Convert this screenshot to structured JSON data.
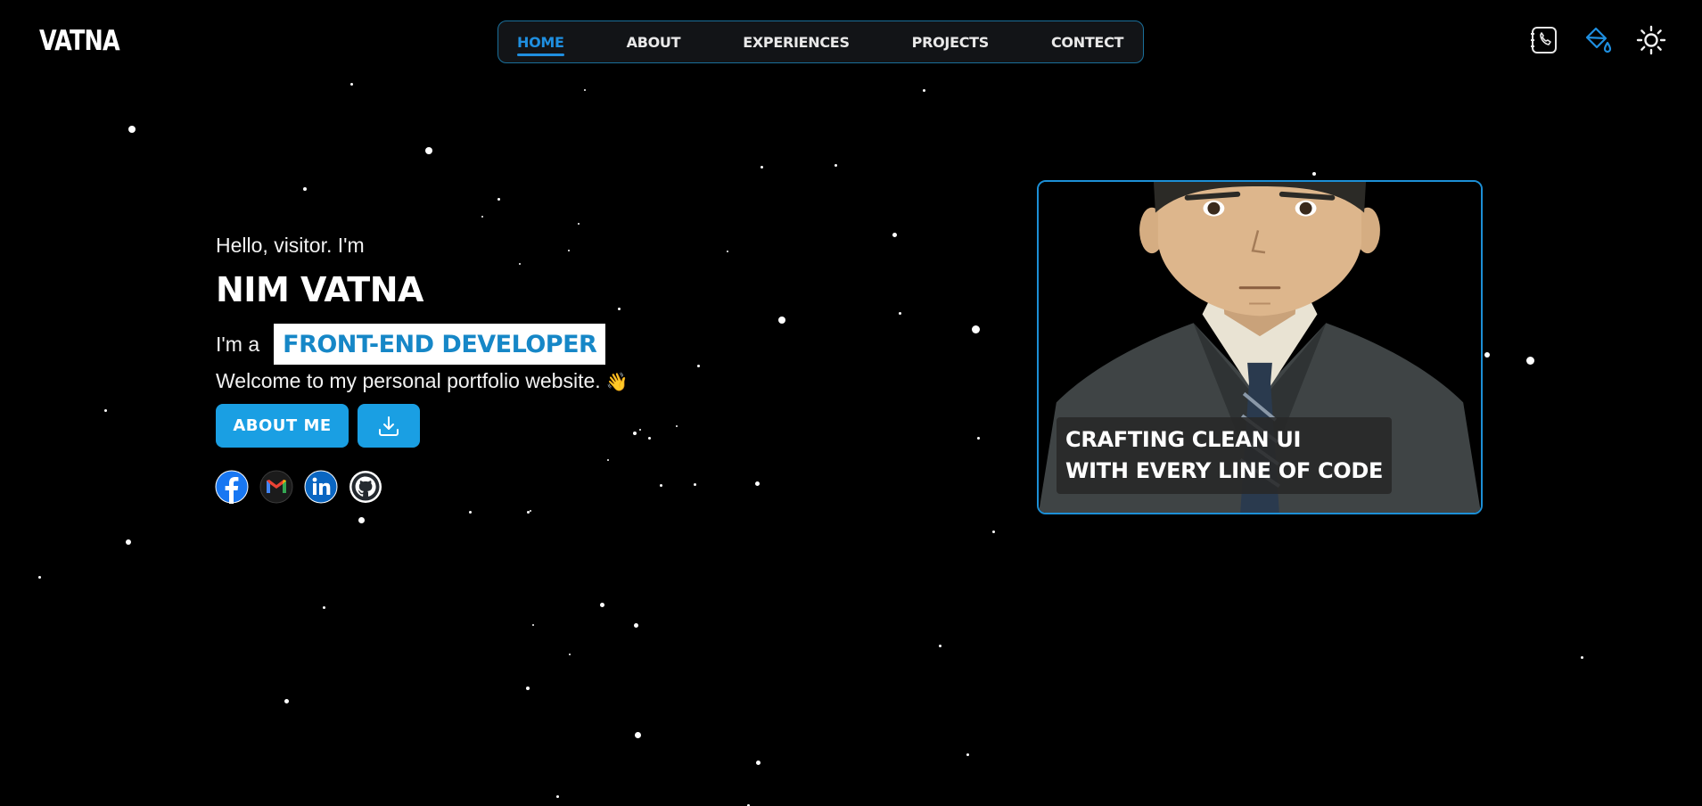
{
  "header": {
    "logo": "VATNA",
    "nav": [
      {
        "label": "HOME",
        "active": true
      },
      {
        "label": "ABOUT",
        "active": false
      },
      {
        "label": "EXPERIENCES",
        "active": false
      },
      {
        "label": "PROJECTS",
        "active": false
      },
      {
        "label": "CONTECT",
        "active": false
      }
    ],
    "icons": [
      "phone-icon",
      "paint-bucket-icon",
      "sun-icon"
    ]
  },
  "hero": {
    "greeting": "Hello, visitor. I'm",
    "name": "NIM VATNA",
    "role_prefix": "I'm a",
    "role": "FRONT-END DEVELOPER",
    "welcome": "Welcome to my personal portfolio website.",
    "wave_emoji": "👋",
    "about_button": "ABOUT ME",
    "download_icon": "download-icon",
    "socials": [
      "facebook-icon",
      "gmail-icon",
      "linkedin-icon",
      "github-icon"
    ]
  },
  "card": {
    "caption_lines": [
      "CRAFTING CLEAN UI",
      "WITH EVERY LINE OF CODE"
    ]
  },
  "colors": {
    "background": "#000000",
    "accent": "#1a9fe3",
    "nav_active": "#1f8fe0",
    "nav_border": "#1a6f9a",
    "card_border": "#1c8fd6"
  }
}
